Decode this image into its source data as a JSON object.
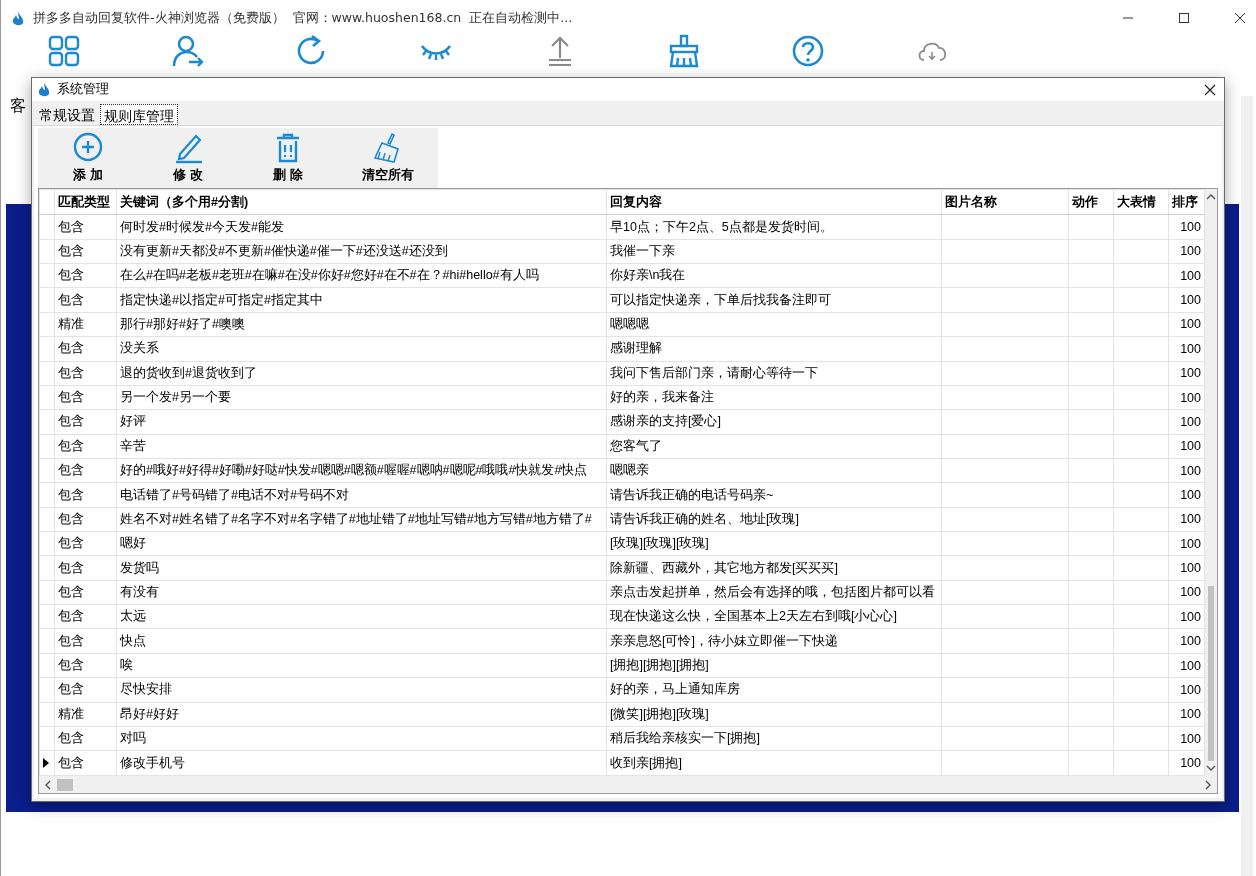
{
  "window": {
    "title": "拼多多自动回复软件-火神浏览器（免费版）",
    "site": "官网：www.huoshen168.cn",
    "status": "正在自动检测中..."
  },
  "main_toolbar": [
    {
      "kind": "grid",
      "disabled": false
    },
    {
      "kind": "user",
      "disabled": false
    },
    {
      "kind": "refresh",
      "disabled": false
    },
    {
      "kind": "eye",
      "disabled": false
    },
    {
      "kind": "upload",
      "disabled": true
    },
    {
      "kind": "broom",
      "disabled": false
    },
    {
      "kind": "help",
      "disabled": false
    },
    {
      "kind": "cloud",
      "disabled": true
    }
  ],
  "side_label": "客",
  "dialog": {
    "title": "系统管理",
    "tabs": [
      {
        "label": "常规设置",
        "selected": false
      },
      {
        "label": "规则库管理",
        "selected": true
      }
    ],
    "actions": [
      {
        "kind": "add",
        "label": "添 加"
      },
      {
        "kind": "edit",
        "label": "修 改"
      },
      {
        "kind": "delete",
        "label": "删 除"
      },
      {
        "kind": "clear",
        "label": "清空所有"
      }
    ],
    "table": {
      "columns": [
        "匹配类型",
        "关键词（多个用#分割)",
        "回复内容",
        "图片名称",
        "动作",
        "大表情",
        "排序"
      ],
      "rows": [
        {
          "match": "包含",
          "keywords": "何时发#时候发#今天发#能发",
          "reply": "早10点；下午2点、5点都是发货时间。",
          "order": "100",
          "current": false
        },
        {
          "match": "包含",
          "keywords": "没有更新#天都没#不更新#催快递#催一下#还没送#还没到",
          "reply": "我催一下亲",
          "order": "100",
          "current": false
        },
        {
          "match": "包含",
          "keywords": "在么#在吗#老板#老班#在嘛#在没#你好#您好#在不#在？#hi#hello#有人吗",
          "reply": "你好亲\\n我在",
          "order": "100",
          "current": false
        },
        {
          "match": "包含",
          "keywords": "指定快递#以指定#可指定#指定其中",
          "reply": "可以指定快递亲，下单后找我备注即可",
          "order": "100",
          "current": false
        },
        {
          "match": "精准",
          "keywords": "那行#那好#好了#噢噢",
          "reply": "嗯嗯嗯",
          "order": "100",
          "current": false
        },
        {
          "match": "包含",
          "keywords": "没关系",
          "reply": "感谢理解",
          "order": "100",
          "current": false
        },
        {
          "match": "包含",
          "keywords": "退的货收到#退货收到了",
          "reply": "我问下售后部门亲，请耐心等待一下",
          "order": "100",
          "current": false
        },
        {
          "match": "包含",
          "keywords": "另一个发#另一个要",
          "reply": "好的亲，我来备注",
          "order": "100",
          "current": false
        },
        {
          "match": "包含",
          "keywords": "好评",
          "reply": "感谢亲的支持[爱心]",
          "order": "100",
          "current": false
        },
        {
          "match": "包含",
          "keywords": "辛苦",
          "reply": "您客气了",
          "order": "100",
          "current": false
        },
        {
          "match": "包含",
          "keywords": "好的#哦好#好得#好嘞#好哒#快发#嗯嗯#嗯额#喔喔#嗯呐#嗯呢#哦哦#快就发#快点",
          "reply": "嗯嗯亲",
          "order": "100",
          "current": false
        },
        {
          "match": "包含",
          "keywords": "电话错了#号码错了#电话不对#号码不对",
          "reply": "请告诉我正确的电话号码亲~",
          "order": "100",
          "current": false
        },
        {
          "match": "包含",
          "keywords": "姓名不对#姓名错了#名字不对#名字错了#地址错了#地址写错#地方写错#地方错了#",
          "reply": "请告诉我正确的姓名、地址[玫瑰]",
          "order": "100",
          "current": false
        },
        {
          "match": "包含",
          "keywords": "嗯好",
          "reply": "[玫瑰][玫瑰][玫瑰]",
          "order": "100",
          "current": false
        },
        {
          "match": "包含",
          "keywords": "发货吗",
          "reply": "除新疆、西藏外，其它地方都发[买买买]",
          "order": "100",
          "current": false
        },
        {
          "match": "包含",
          "keywords": "有没有",
          "reply": "亲点击发起拼单，然后会有选择的哦，包括图片都可以看",
          "order": "100",
          "current": false
        },
        {
          "match": "包含",
          "keywords": "太远",
          "reply": "现在快递这么快，全国基本上2天左右到哦[小心心]",
          "order": "100",
          "current": false
        },
        {
          "match": "包含",
          "keywords": "快点",
          "reply": "亲亲息怒[可怜]，待小妹立即催一下快递",
          "order": "100",
          "current": false
        },
        {
          "match": "包含",
          "keywords": "唉",
          "reply": "[拥抱][拥抱][拥抱]",
          "order": "100",
          "current": false
        },
        {
          "match": "包含",
          "keywords": "尽快安排",
          "reply": "好的亲，马上通知库房",
          "order": "100",
          "current": false
        },
        {
          "match": "精准",
          "keywords": "昂好#好好",
          "reply": "[微笑][拥抱][玫瑰]",
          "order": "100",
          "current": false
        },
        {
          "match": "包含",
          "keywords": "对吗",
          "reply": "稍后我给亲核实一下[拥抱]",
          "order": "100",
          "current": false
        },
        {
          "match": "包含",
          "keywords": "修改手机号",
          "reply": "收到亲[拥抱]",
          "order": "100",
          "current": true
        }
      ]
    }
  }
}
